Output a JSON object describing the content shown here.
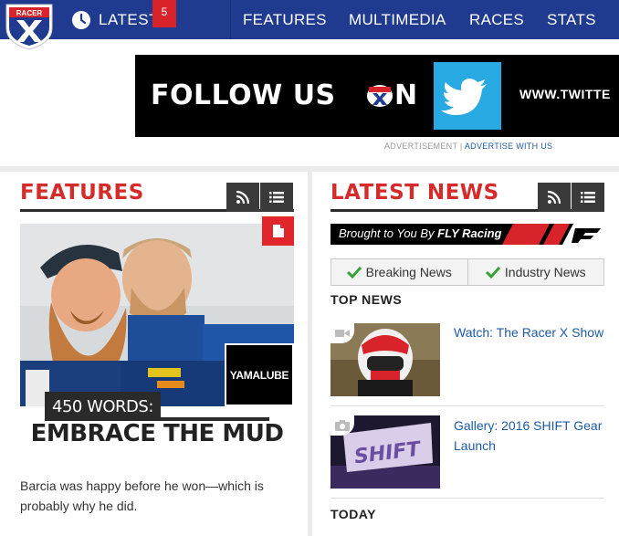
{
  "header": {
    "logo_alt": "RACER X",
    "latest_label": "LATEST",
    "latest_count": "5",
    "nav": [
      "FEATURES",
      "MULTIMEDIA",
      "RACES",
      "STATS"
    ]
  },
  "ad": {
    "follow_text": "FOLLOW US",
    "follow_suffix": "N",
    "url_text": "WWW.TWITTE",
    "note": "ADVERTISEMENT",
    "separator": "|",
    "advertise_link": "ADVERTISE WITH US"
  },
  "features": {
    "title": "FEATURES",
    "sponsor_badge": "YAMALUBE",
    "kicker": "450 WORDS:",
    "headline": "EMBRACE THE MUD",
    "dek": "Barcia was happy before he won—which is probably why he did."
  },
  "latest_news": {
    "title": "LATEST NEWS",
    "sponsor_prefix": "Brought to You By ",
    "sponsor_brand": "FLY Racing",
    "tabs": [
      "Breaking News",
      "Industry News"
    ],
    "top_news_label": "TOP NEWS",
    "stories": [
      {
        "title": "Watch: The Racer X Show",
        "media": "video-icon"
      },
      {
        "title": "Gallery: 2016 SHIFT Gear Launch",
        "media": "camera-icon",
        "thumb_text": "SHIFT"
      }
    ],
    "today_label": "TODAY"
  },
  "colors": {
    "nav_blue": "#1f3a8f",
    "accent_red": "#d52b2b",
    "link_blue": "#1f5aa8",
    "twitter_blue": "#29a9e1"
  }
}
